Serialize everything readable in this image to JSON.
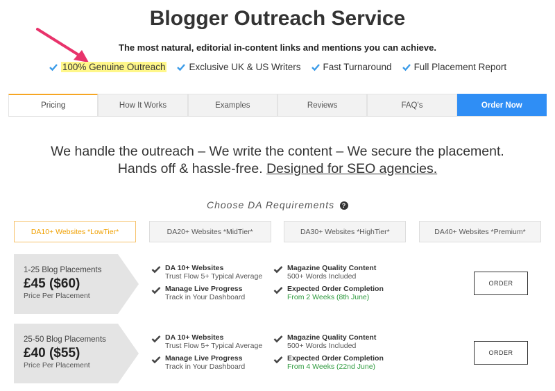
{
  "header": {
    "title": "Blogger Outreach Service",
    "subtitle": "The most natural, editorial in-content links and mentions you can achieve."
  },
  "features": [
    {
      "label": "100% Genuine Outreach",
      "highlighted": true
    },
    {
      "label": "Exclusive UK & US Writers"
    },
    {
      "label": "Fast Turnaround"
    },
    {
      "label": "Full Placement Report"
    }
  ],
  "tabs": [
    {
      "label": "Pricing",
      "active": true
    },
    {
      "label": "How It Works"
    },
    {
      "label": "Examples"
    },
    {
      "label": "Reviews"
    },
    {
      "label": "FAQ's"
    },
    {
      "label": "Order Now"
    }
  ],
  "headline": {
    "line1": "We handle the outreach – We write the content – We secure the placement.",
    "line2_text": "Hands off & hassle-free.",
    "line2_link": "Designed for SEO agencies."
  },
  "da_section": {
    "title": "Choose DA Requirements",
    "help_glyph": "?",
    "tabs": [
      {
        "label": "DA10+ Websites *LowTier*",
        "active": true
      },
      {
        "label": "DA20+ Websites *MidTier*"
      },
      {
        "label": "DA30+ Websites *HighTier*"
      },
      {
        "label": "DA40+ Websites *Premium*"
      }
    ]
  },
  "tiers": [
    {
      "range": "1-25 Blog Placements",
      "price": "£45 ($60)",
      "price_label": "Price Per Placement",
      "features": [
        {
          "title": "DA 10+ Websites",
          "sub": "Trust Flow 5+ Typical Average"
        },
        {
          "title": "Magazine Quality Content",
          "sub": "500+ Words Included"
        },
        {
          "title": "Manage Live Progress",
          "sub": "Track in Your Dashboard"
        },
        {
          "title": "Expected Order Completion",
          "sub": "From 2 Weeks (8th June)"
        }
      ],
      "order_label": "ORDER"
    },
    {
      "range": "25-50 Blog Placements",
      "price": "£40 ($55)",
      "price_label": "Price Per Placement",
      "features": [
        {
          "title": "DA 10+ Websites",
          "sub": "Trust Flow 5+ Typical Average"
        },
        {
          "title": "Magazine Quality Content",
          "sub": "500+ Words Included"
        },
        {
          "title": "Manage Live Progress",
          "sub": "Track in Your Dashboard"
        },
        {
          "title": "Expected Order Completion",
          "sub": "From 4 Weeks (22nd June)"
        }
      ],
      "order_label": "ORDER"
    }
  ],
  "colors": {
    "accent_orange": "#f6a623",
    "order_blue": "#2f8ef5",
    "check_blue": "#3a9be8",
    "highlight_yellow": "#fff78a",
    "annotation_pink": "#e8336b",
    "green_text": "#2e9a3e"
  },
  "icons": {
    "feature_check": "check-icon",
    "tier_tick": "tick-icon",
    "help": "help-circle-icon",
    "annotation": "arrow-annotation-icon"
  }
}
